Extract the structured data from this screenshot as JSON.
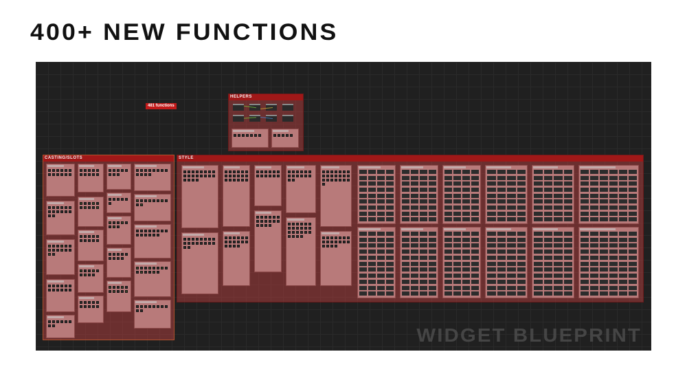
{
  "title": "400+ NEW FUNCTIONS",
  "watermark": "WIDGET BLUEPRINT",
  "labels": {
    "functions": "481 functions",
    "helpers": "HELPERS",
    "casting": "CASTING/SLOTS",
    "style": "STYLE"
  }
}
